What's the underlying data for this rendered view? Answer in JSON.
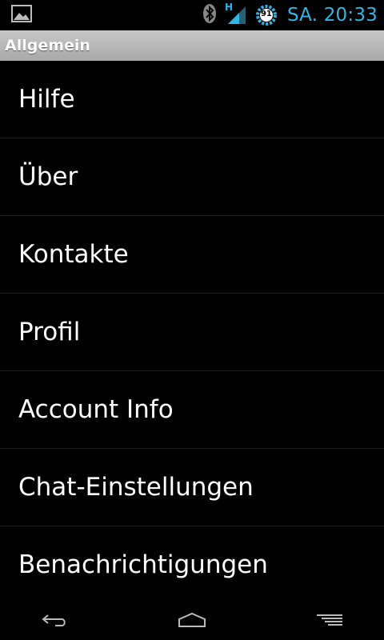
{
  "status_bar": {
    "time": "SA. 20:33",
    "battery_level": "91",
    "network_type": "H",
    "icons": [
      "picture-icon",
      "bluetooth-icon",
      "signal-icon",
      "battery-icon"
    ],
    "accent_color": "#33b5e5"
  },
  "header": {
    "title": "Allgemein"
  },
  "menu": {
    "items": [
      {
        "label": "Hilfe"
      },
      {
        "label": "Über"
      },
      {
        "label": "Kontakte"
      },
      {
        "label": "Profil"
      },
      {
        "label": "Account Info"
      },
      {
        "label": "Chat-Einstellungen"
      },
      {
        "label": "Benachrichtigungen"
      }
    ]
  },
  "nav_bar": {
    "icons": [
      "back-icon",
      "home-icon",
      "menu-icon"
    ]
  }
}
